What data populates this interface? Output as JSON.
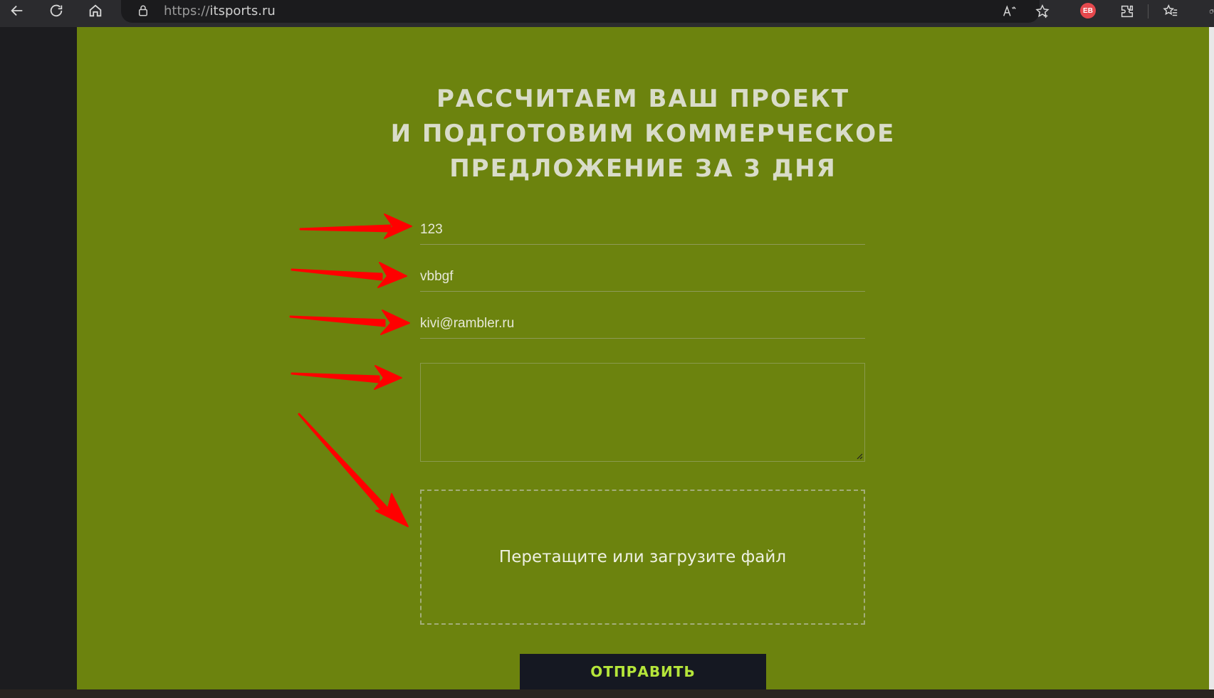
{
  "browser": {
    "url_protocol": "https://",
    "url_host": "itsports.ru",
    "extension_badge": "ЕВ"
  },
  "form": {
    "heading_lines": [
      "РАССЧИТАЕМ ВАШ ПРОЕКТ",
      "И ПОДГОТОВИМ КОММЕРЧЕСКОЕ",
      "ПРЕДЛОЖЕНИЕ ЗА 3 ДНЯ"
    ],
    "field_1_value": "123",
    "field_2_value": "vbbgf",
    "email_value": "kivi@rambler.ru",
    "message_value": "",
    "dropzone_label": "Перетащите или загрузите файл",
    "submit_label": "ОТПРАВИТЬ"
  },
  "colors": {
    "page_background": "#6c830e",
    "submit_background": "#151822",
    "submit_text": "#b5e53a",
    "annotation_arrow": "#ff0000"
  },
  "annotations": {
    "arrow_count": 5
  }
}
